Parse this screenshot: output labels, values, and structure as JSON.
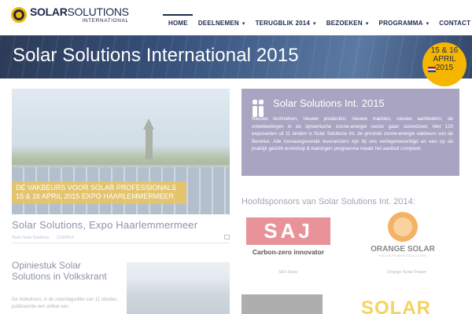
{
  "header": {
    "logo": {
      "word_bold": "SOLAR",
      "word_rest": "SOLUTIONS",
      "sub": "INTERNATIONAL"
    },
    "nav": [
      {
        "label": "HOME",
        "active": true,
        "dropdown": false
      },
      {
        "label": "DEELNEMEN",
        "active": false,
        "dropdown": true
      },
      {
        "label": "TERUGBLIK 2014",
        "active": false,
        "dropdown": true
      },
      {
        "label": "BEZOEKEN",
        "active": false,
        "dropdown": true
      },
      {
        "label": "PROGRAMMA",
        "active": false,
        "dropdown": true
      },
      {
        "label": "CONTACT",
        "active": false,
        "dropdown": true
      }
    ]
  },
  "banner": {
    "title": "Solar Solutions International 2015",
    "badge": {
      "line1": "15 & 16",
      "line2": "APRIL",
      "line3": "2015"
    }
  },
  "feature": {
    "caption_line1": "DE VAKBEURS VOOR SOLAR PROFESSIONALS",
    "caption_line2": "15 & 16 APRIL 2015 EXPO HAARLEMMERMEER",
    "title": "Solar Solutions, Expo Haarlemmermeer",
    "author": "Team Solar Solutions",
    "date": "1/10/2014"
  },
  "opinie": {
    "title": "Opiniestuk Solar Solutions in Volkskrant",
    "text": "De Volkskrant, in de zaterdageditie van 11 oktober, publiceerde een artikel van"
  },
  "infobox": {
    "title": "Solar Solutions Int. 2015",
    "text": "Nieuwe technieken, nieuwe producten, nieuwe markten, nieuwe aanbieders; de ontwikkelingen in de dynamische zonne-energie sector gaan razendsnel. Met 120 exposanten uit 11 landen is Solar Solutions Int. de grootste zonne-energie vakbeurs van de Benelux. Alle toonaangevende leveranciers zijn bij ons vertegenwoordigd en een op de praktijk gericht workshop & trainingen programma maakt het aanbod compleet."
  },
  "sponsors": {
    "title": "Hoofdsponsors van Solar Solutions Int. 2014:",
    "items": [
      {
        "logo_text": "SAJ",
        "tagline": "Carbon-zero innovator",
        "caption": "SAJ Solar"
      },
      {
        "logo_text": "ORANGE SOLAR",
        "tagline": "SOLAR POWER SOLUTIONS",
        "caption": "Orange Solar Power"
      }
    ],
    "partial_logo_text": "SOLAR"
  },
  "colors": {
    "navy": "#1d2a4c",
    "brand_yellow": "#f5b600",
    "info_purple": "#a9a4c2",
    "muted_text": "#8c94a6"
  }
}
